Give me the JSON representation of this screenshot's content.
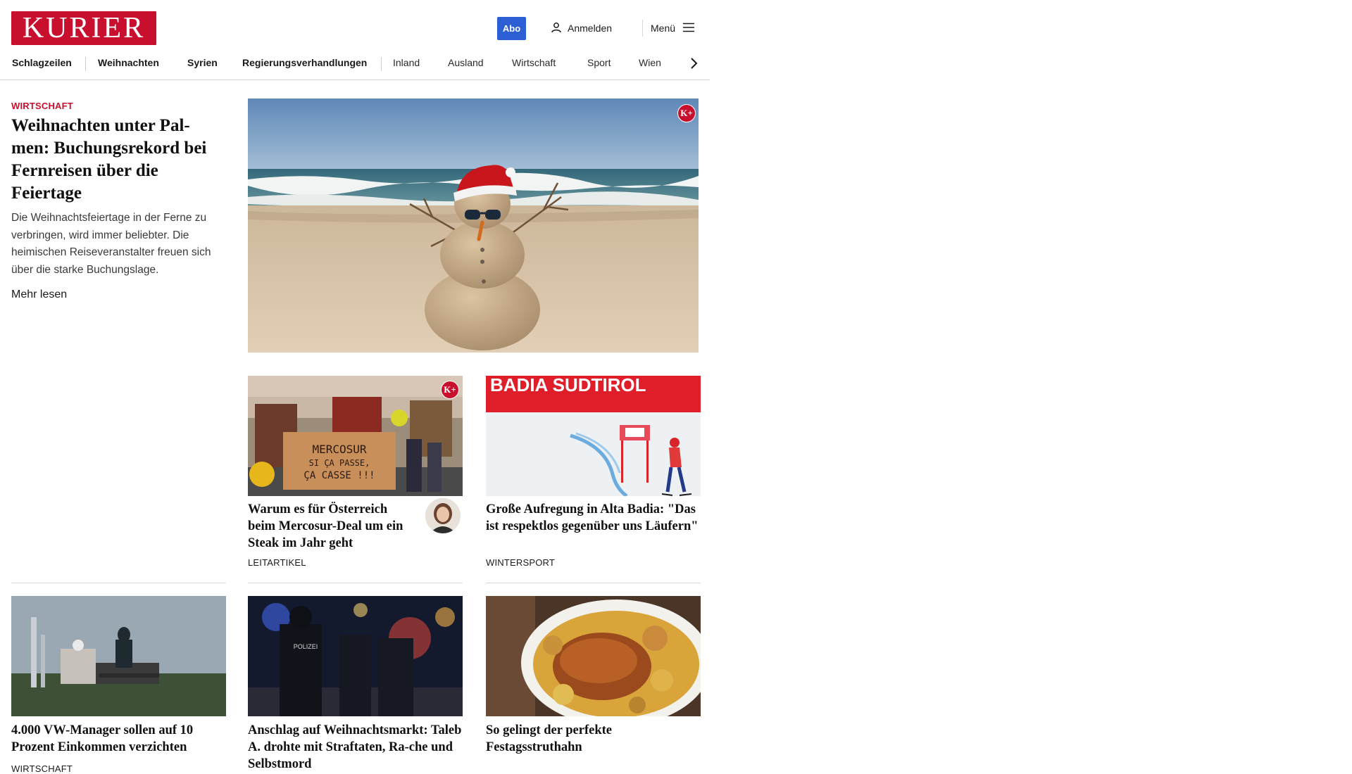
{
  "header": {
    "logo_text": "KURIER",
    "abo_label": "Abo",
    "login_label": "Anmelden",
    "menu_label": "Menü",
    "brand_color": "#c8102e",
    "abo_color": "#2c5fd4"
  },
  "nav": {
    "items": [
      {
        "label": "Schlagzeilen"
      },
      {
        "label": "Weihnachten"
      },
      {
        "label": "Syrien"
      },
      {
        "label": "Regierungsverhandlungen"
      },
      {
        "label": "Inland"
      },
      {
        "label": "Ausland"
      },
      {
        "label": "Wirtschaft"
      },
      {
        "label": "Sport"
      },
      {
        "label": "Wien"
      }
    ],
    "next_icon": "chevron-right-icon"
  },
  "lead": {
    "kicker": "WIRTSCHAFT",
    "title": "Weihnachten unter Pal-men: Buchungsrekord bei Fernreisen über die Feiertage",
    "teaser": "Die Weihnachtsfeiertage in der Ferne zu verbringen, wird immer beliebter. Die heimischen Reiseveranstalter freuen sich über die starke Buchungslage.",
    "more_label": "Mehr lesen",
    "badge": "K+"
  },
  "cards": [
    {
      "title": "Warum es für Österreich beim Mercosur-Deal um ein Steak im Jahr geht",
      "tag": "LEITARTIKEL",
      "badge": "K+",
      "image_sign_line1": "MERCOSUR",
      "image_sign_line2": "SI ÇA PASSE,",
      "image_sign_line3": "ÇA CASSE !!!"
    },
    {
      "title": "Große Aufregung in Alta Badia: \"Das ist respektlos gegenüber uns Läufern\"",
      "tag": "WINTERSPORT",
      "image_banner": "BADIA SUDTIROL"
    },
    {
      "title": "4.000 VW-Manager sollen auf 10 Prozent Einkommen verzichten",
      "tag": "WIRTSCHAFT"
    },
    {
      "title": "Anschlag auf Weihnachtsmarkt: Taleb A. drohte mit Straftaten, Ra-che und Selbstmord",
      "tag": "",
      "image_text": "POLIZEI"
    },
    {
      "title": "So gelingt der perfekte Festagsstruthahn",
      "tag": ""
    }
  ]
}
